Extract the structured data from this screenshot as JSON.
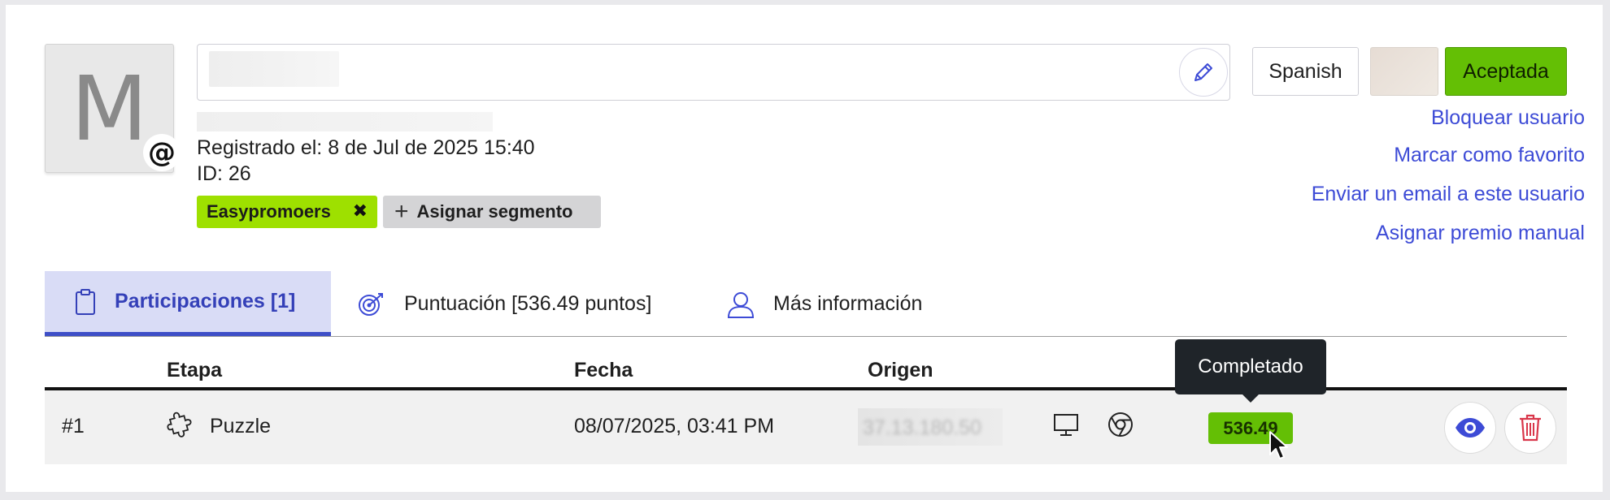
{
  "profile": {
    "avatar_letter": "M",
    "at_symbol": "@",
    "registered": "Registrado el: 8 de Jul de 2025 15:40",
    "id_text": "ID: 26",
    "segment_label": "Easypromoers",
    "segment_remove": "✖",
    "assign_segment_label": "Asignar segmento"
  },
  "header_actions": {
    "language": "Spanish",
    "status": "Aceptada",
    "status_color": "#64bf05",
    "links": [
      "Bloquear usuario",
      "Marcar como favorito",
      "Enviar un email a este usuario",
      "Asignar premio manual"
    ]
  },
  "tabs": [
    {
      "label": "Participaciones [1]",
      "icon": "clipboard-icon",
      "active": true
    },
    {
      "label": "Puntuación [536.49 puntos]",
      "icon": "target-icon",
      "active": false
    },
    {
      "label": "Más información",
      "icon": "user-icon",
      "active": false
    }
  ],
  "table": {
    "headers": [
      "Etapa",
      "Fecha",
      "Origen"
    ],
    "rows": [
      {
        "number": "#1",
        "stage": "Puzzle",
        "stage_icon": "puzzle-icon",
        "date": "08/07/2025, 03:41 PM",
        "origin_ip_partial": "37.13.180.50",
        "device_icon": "desktop-icon",
        "browser_icon": "chrome-icon",
        "points": "536.49"
      }
    ]
  },
  "tooltip": "Completado",
  "colors": {
    "accent": "#3d4bd6",
    "active_tab_bg": "#d9dcf6",
    "segment_chip": "#9ee000",
    "delete": "#d9364a"
  }
}
